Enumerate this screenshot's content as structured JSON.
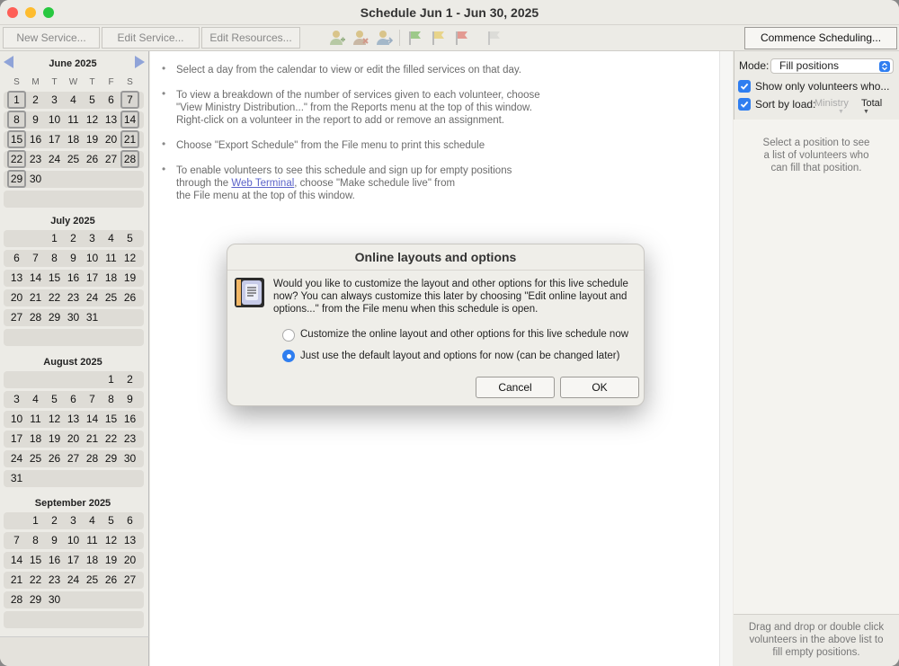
{
  "window": {
    "title": "Schedule Jun 1 - Jun 30, 2025"
  },
  "toolbar": {
    "new_service": "New Service...",
    "edit_service": "Edit Service...",
    "edit_resources": "Edit Resources...",
    "commence": "Commence Scheduling..."
  },
  "calendar": {
    "weekdays": [
      "S",
      "M",
      "T",
      "W",
      "T",
      "F",
      "S"
    ],
    "months": [
      {
        "title": "June 2025",
        "first_weekday": 0,
        "days": 30,
        "selected_days": [
          1,
          7,
          8,
          14,
          15,
          21,
          22,
          28,
          29
        ]
      },
      {
        "title": "July 2025",
        "first_weekday": 2,
        "days": 31,
        "selected_days": []
      },
      {
        "title": "August 2025",
        "first_weekday": 5,
        "days": 31,
        "selected_days": []
      },
      {
        "title": "September 2025",
        "first_weekday": 1,
        "days": 30,
        "selected_days": []
      }
    ]
  },
  "instructions": {
    "item1_line1": "Select a day from the calendar to view or edit the filled services on that day.",
    "item2_line1": "To view a breakdown of the number of services given to each volunteer, choose",
    "item2_line2": "\"View Ministry Distribution...\" from the Reports menu at the top of this window.",
    "item2_line3": "Right-click on a volunteer in the report to add or remove an assignment.",
    "item3_line1": "Choose \"Export Schedule\" from the File menu to print this schedule",
    "item4_line1": "To enable volunteers to see this schedule and sign up for empty positions",
    "item4_line2_prefix": "through the ",
    "item4_link": "Web Terminal",
    "item4_line2_suffix": ", choose \"Make schedule live\" from",
    "item4_line3": "the File menu at the top of this window."
  },
  "right_panel": {
    "mode_label": "Mode:",
    "mode_value": "Fill positions",
    "show_only_label": "Show only volunteers who...",
    "sort_label": "Sort by load:",
    "sort_col_ministry": "Ministry",
    "sort_col_total": "Total",
    "list_hint_line1": "Select a position to see",
    "list_hint_line2": "a list of volunteers who",
    "list_hint_line3": "can fill that position.",
    "footer_line1": "Drag and drop or double click",
    "footer_line2": "volunteers in the above list to",
    "footer_line3": "fill empty positions."
  },
  "dialog": {
    "title": "Online layouts and options",
    "msg_line1": "Would you like to customize the layout and other options for this live schedule",
    "msg_line2": "now? You can always customize this later by choosing \"Edit online layout and",
    "msg_line3": "options...\" from the File menu when this schedule is open.",
    "option1": "Customize the online layout and other options for this live schedule now",
    "option2": "Just use the default layout and options for now (can be changed later)",
    "selected_option": 2,
    "cancel": "Cancel",
    "ok": "OK"
  },
  "colors": {
    "accent": "#2f7ef0",
    "link": "#5b63c9"
  }
}
